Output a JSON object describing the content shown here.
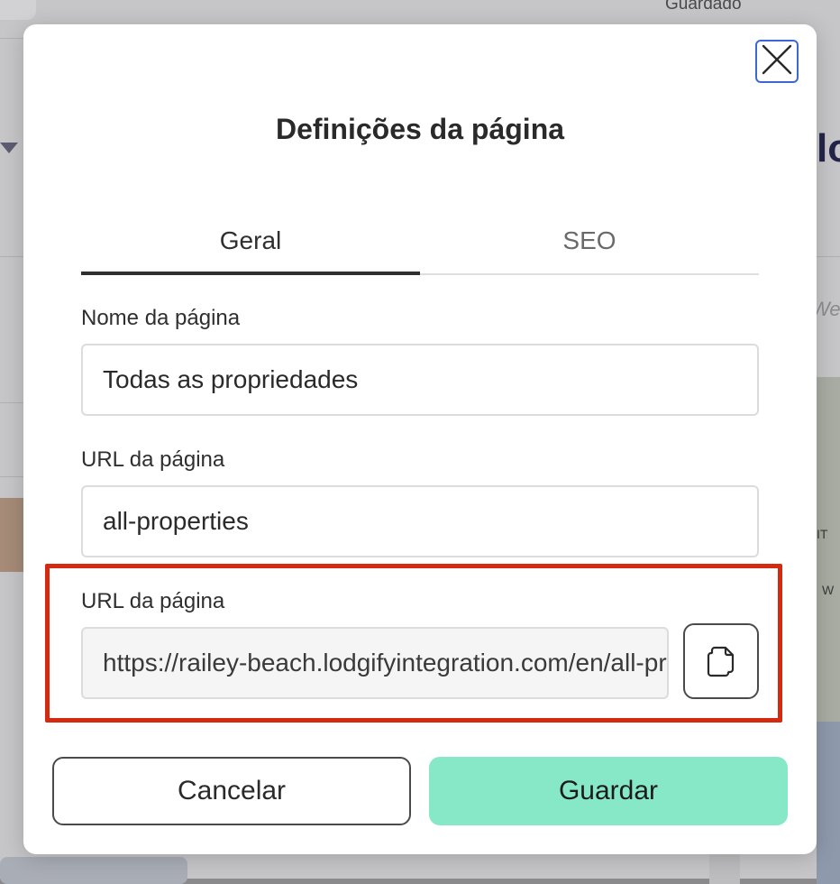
{
  "background": {
    "saved_status": "Guardado",
    "right_heading_fragment": "lo",
    "right_text_fragment": "We",
    "map_label_1": "IT",
    "map_label_2": "W"
  },
  "modal": {
    "title": "Definições da página",
    "close_icon": "close-icon",
    "tabs": [
      {
        "label": "Geral",
        "active": true
      },
      {
        "label": "SEO",
        "active": false
      }
    ],
    "page_name": {
      "label": "Nome da página",
      "value": "Todas as propriedades"
    },
    "page_url": {
      "label": "URL da página",
      "value": "all-properties"
    },
    "full_url": {
      "label": "URL da página",
      "value": "https://railey-beach.lodgifyintegration.com/en/all-properties",
      "copy_icon": "copy-icon"
    },
    "buttons": {
      "cancel": "Cancelar",
      "save": "Guardar"
    }
  },
  "colors": {
    "accent_save": "#86e8c6",
    "focus_outline": "#3c68d6",
    "highlight_red": "#d42a10"
  }
}
